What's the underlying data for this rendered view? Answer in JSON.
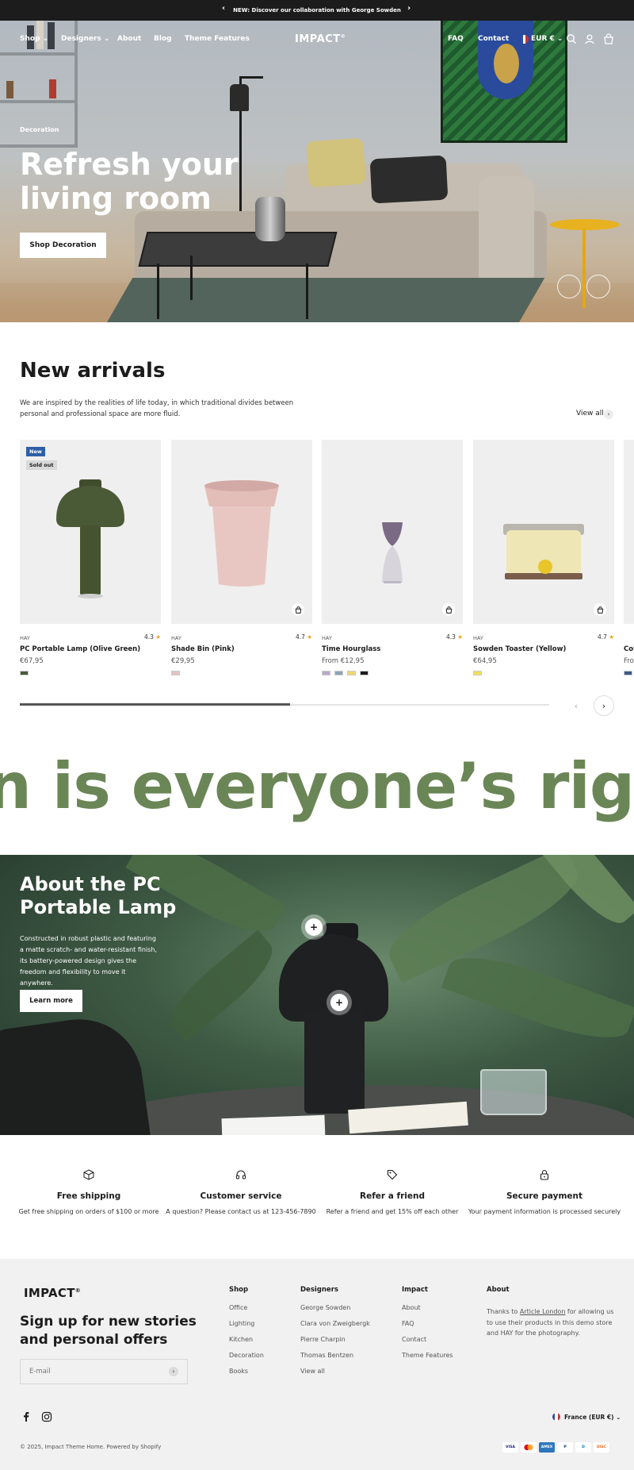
{
  "announcement": {
    "text": "NEW: Discover our collaboration with George Sowden",
    "prev": "‹",
    "next": "›"
  },
  "nav": {
    "left": [
      {
        "label": "Shop",
        "dropdown": true
      },
      {
        "label": "Designers",
        "dropdown": true
      },
      {
        "label": "About"
      },
      {
        "label": "Blog"
      },
      {
        "label": "Theme Features"
      }
    ],
    "logo": "IMPACT",
    "logo_mark": "®",
    "right": [
      "FAQ",
      "Contact"
    ],
    "currency": "EUR €",
    "icons": [
      "search-icon",
      "account-icon",
      "cart-icon"
    ]
  },
  "hero": {
    "eyebrow": "Decoration",
    "title": "Refresh your living room",
    "button": "Shop Decoration"
  },
  "new_arrivals": {
    "title": "New arrivals",
    "description": "We are inspired by the realities of life today, in which traditional divides between personal and professional space are more fluid.",
    "view_all": "View all",
    "products": [
      {
        "vendor": "HAY",
        "name": "PC Portable Lamp (Olive Green)",
        "price": "€67,95",
        "rating": "4.3",
        "badges": [
          "New",
          "Sold out"
        ],
        "swatches": [
          "#4b5a3a"
        ]
      },
      {
        "vendor": "HAY",
        "name": "Shade Bin (Pink)",
        "price": "€29,95",
        "rating": "4.7",
        "badges": [],
        "swatches": [
          "#e6c2bf"
        ]
      },
      {
        "vendor": "HAY",
        "name": "Time Hourglass",
        "price": "From €12,95",
        "rating": "4.3",
        "badges": [],
        "swatches": [
          "#b9a9c9",
          "#8fa3b7",
          "#f1d571",
          "#1c1c1c"
        ]
      },
      {
        "vendor": "HAY",
        "name": "Sowden Toaster (Yellow)",
        "price": "€64,95",
        "rating": "4.7",
        "badges": [],
        "swatches": [
          "#f2dd5c"
        ]
      },
      {
        "vendor": "",
        "name": "Col",
        "price": "From",
        "rating": "",
        "badges": [],
        "swatches": [
          "#3d5a8a"
        ]
      }
    ],
    "scroll_progress": 0.51,
    "prev": "‹",
    "next": "›"
  },
  "marquee": {
    "text": "n is everyone’s right.   G"
  },
  "about_lamp": {
    "title": "About the PC Portable Lamp",
    "text": "Constructed in robust plastic and featuring a matte scratch- and water-resistant finish, its battery-powered design gives the freedom and flexibility to move it anywhere.",
    "button": "Learn more",
    "hotspot": "+"
  },
  "features": [
    {
      "icon": "box-icon",
      "title": "Free shipping",
      "text": "Get free shipping on orders of $100 or more"
    },
    {
      "icon": "headset-icon",
      "title": "Customer service",
      "text": "A question? Please contact us at 123-456-7890"
    },
    {
      "icon": "tag-icon",
      "title": "Refer a friend",
      "text": "Refer a friend and get 15% off each other"
    },
    {
      "icon": "lock-icon",
      "title": "Secure payment",
      "text": "Your payment information is processed securely"
    }
  ],
  "footer": {
    "logo": "IMPACT",
    "logo_mark": "®",
    "signup_title": "Sign up for new stories and personal offers",
    "email_placeholder": "E-mail",
    "columns": [
      {
        "title": "Shop",
        "links": [
          "Office",
          "Lighting",
          "Kitchen",
          "Decoration",
          "Books"
        ]
      },
      {
        "title": "Designers",
        "links": [
          "George Sowden",
          "Clara von Zweigbergk",
          "Pierre Charpin",
          "Thomas Bentzen",
          "View all"
        ]
      },
      {
        "title": "Impact",
        "links": [
          "About",
          "FAQ",
          "Contact",
          "Theme Features"
        ]
      }
    ],
    "about_title": "About",
    "about_pre": "Thanks to ",
    "about_link": "Article London",
    "about_post": " for allowing us to use their products in this demo store and HAY for the photography.",
    "country": "France (EUR €)",
    "copyright": "© 2025, Impact Theme Home. Powered by Shopify",
    "payments": [
      "VISA",
      "MC",
      "AMEX",
      "P",
      "D",
      "DISC"
    ]
  },
  "colors": {
    "accent_green": "#6b8656",
    "dark": "#1c1c1c",
    "footer_bg": "#f1f1f1",
    "badge_new": "#2d5fa8",
    "star": "#f0a21c"
  }
}
